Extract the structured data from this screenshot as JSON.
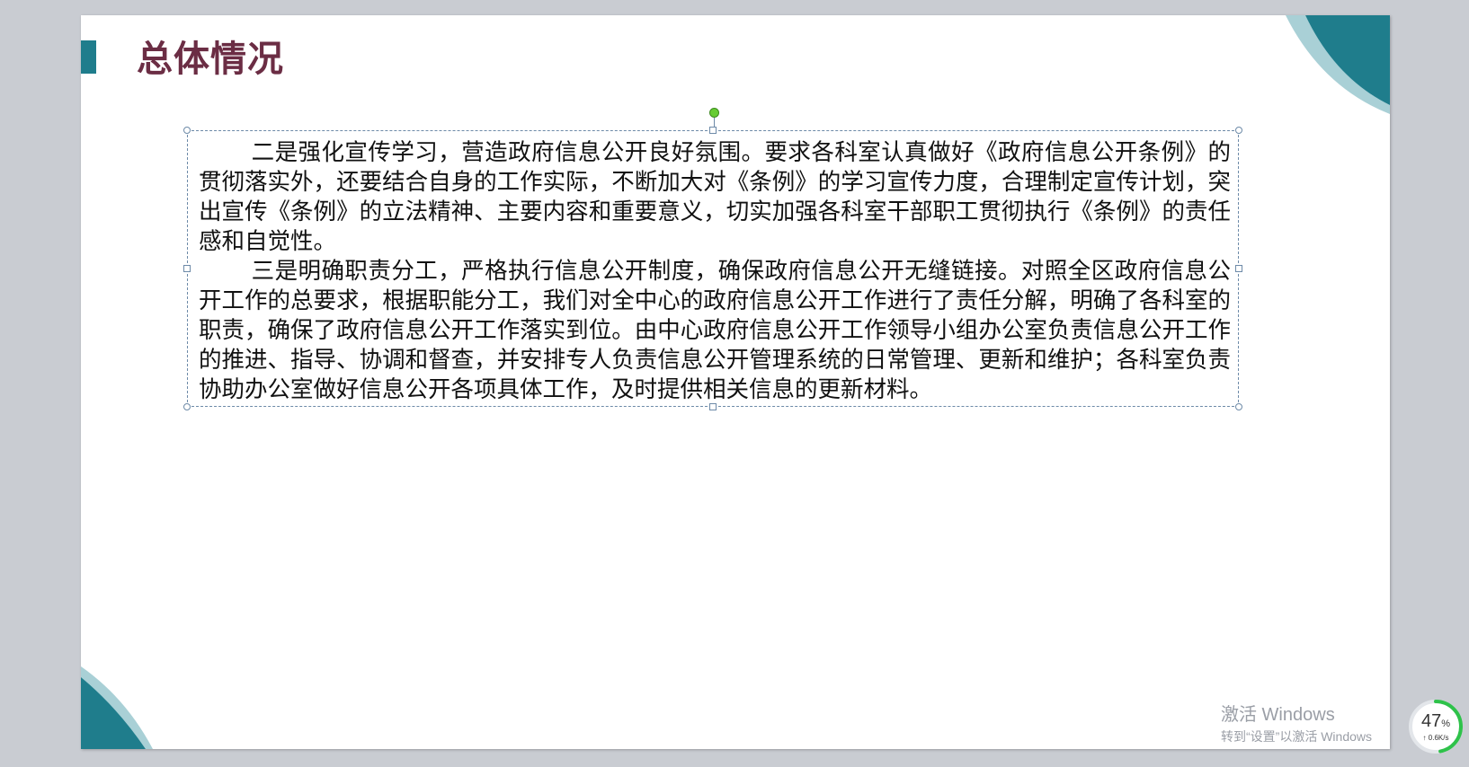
{
  "slide": {
    "title": "总体情况",
    "paragraphs": [
      "二是强化宣传学习，营造政府信息公开良好氛围。要求各科室认真做好《政府信息公开条例》的贯彻落实外，还要结合自身的工作实际，不断加大对《条例》的学习宣传力度，合理制定宣传计划，突出宣传《条例》的立法精神、主要内容和重要意义，切实加强各科室干部职工贯彻执行《条例》的责任感和自觉性。",
      "三是明确职责分工，严格执行信息公开制度，确保政府信息公开无缝链接。对照全区政府信息公开工作的总要求，根据职能分工，我们对全中心的政府信息公开工作进行了责任分解，明确了各科室的职责，确保了政府信息公开工作落实到位。由中心政府信息公开工作领导小组办公室负责信息公开工作的推进、指导、协调和督查，并安排专人负责信息公开管理系统的日常管理、更新和维护；各科室负责协助办公室做好信息公开各项具体工作，及时提供相关信息的更新材料。"
    ]
  },
  "watermark": {
    "title": "激活 Windows",
    "subtitle": "转到“设置”以激活 Windows"
  },
  "network_widget": {
    "percent": "47",
    "percent_unit": "%",
    "speed": "↑ 0.6K/s",
    "level": 0.47
  },
  "colors": {
    "accent_teal": "#1f7d8c",
    "accent_light": "#a9d0d6",
    "title_color": "#6b2d44",
    "rotate_handle": "#66cc33",
    "widget_ring": "#2ec24a"
  }
}
